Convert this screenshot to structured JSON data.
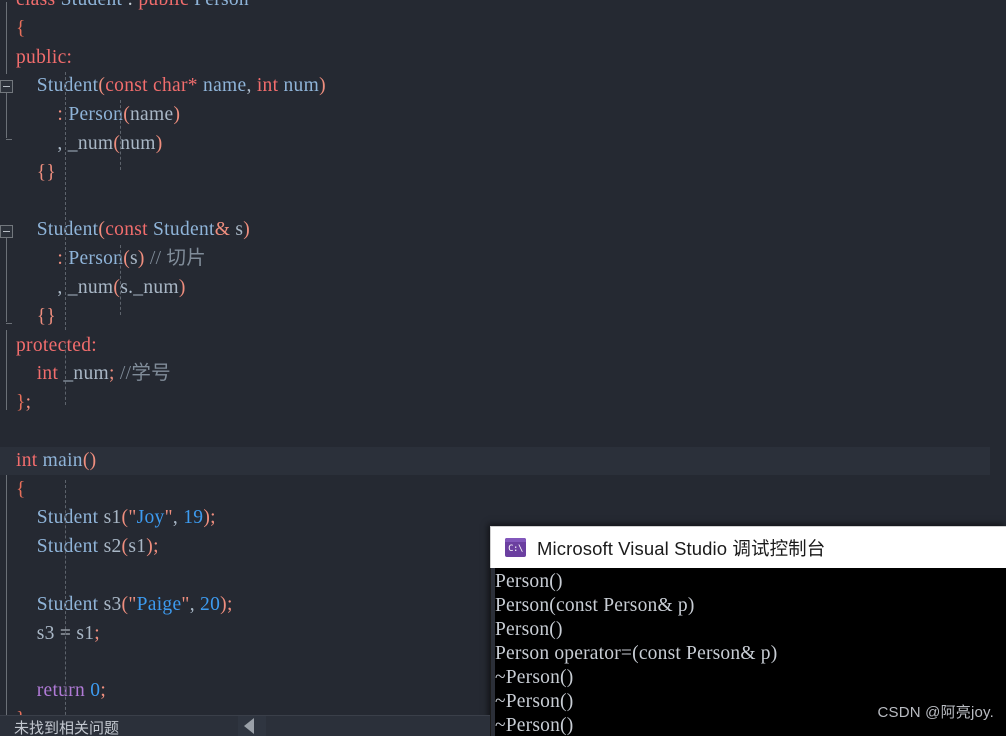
{
  "window": {
    "app": "Visual Studio Code Editor",
    "language": "C++"
  },
  "editor": {
    "lines": [
      {
        "indent": 0,
        "tokens": [
          {
            "t": "class ",
            "c": "kw"
          },
          {
            "t": "Student ",
            "c": "type"
          },
          {
            "t": ": ",
            "c": "op"
          },
          {
            "t": "public ",
            "c": "kw"
          },
          {
            "t": "Person",
            "c": "type"
          }
        ]
      },
      {
        "indent": 0,
        "tokens": [
          {
            "t": "{",
            "c": "brace"
          }
        ]
      },
      {
        "indent": 0,
        "tokens": [
          {
            "t": "public",
            "c": "kw"
          },
          {
            "t": ":",
            "c": "kw"
          }
        ]
      },
      {
        "indent": 1,
        "tokens": [
          {
            "t": "Student",
            "c": "type"
          },
          {
            "t": "(",
            "c": "punc"
          },
          {
            "t": "const ",
            "c": "kw"
          },
          {
            "t": "char*",
            "c": "kw"
          },
          {
            "t": " name",
            "c": "type"
          },
          {
            "t": ", ",
            "c": "id"
          },
          {
            "t": "int ",
            "c": "kw"
          },
          {
            "t": "num",
            "c": "type"
          },
          {
            "t": ")",
            "c": "punc"
          }
        ]
      },
      {
        "indent": 2,
        "tokens": [
          {
            "t": ": ",
            "c": "punc"
          },
          {
            "t": "Person",
            "c": "type"
          },
          {
            "t": "(",
            "c": "punc"
          },
          {
            "t": "name",
            "c": "id"
          },
          {
            "t": ")",
            "c": "punc"
          }
        ]
      },
      {
        "indent": 2,
        "tokens": [
          {
            "t": ", ",
            "c": "id"
          },
          {
            "t": "_num",
            "c": "id"
          },
          {
            "t": "(",
            "c": "punc"
          },
          {
            "t": "num",
            "c": "id"
          },
          {
            "t": ")",
            "c": "punc"
          }
        ]
      },
      {
        "indent": 1,
        "tokens": [
          {
            "t": "{}",
            "c": "punc"
          }
        ]
      },
      {
        "indent": 0,
        "tokens": []
      },
      {
        "indent": 1,
        "tokens": [
          {
            "t": "Student",
            "c": "type"
          },
          {
            "t": "(",
            "c": "punc"
          },
          {
            "t": "const ",
            "c": "kw"
          },
          {
            "t": "Student",
            "c": "type"
          },
          {
            "t": "& ",
            "c": "punc"
          },
          {
            "t": "s",
            "c": "id"
          },
          {
            "t": ")",
            "c": "punc"
          }
        ]
      },
      {
        "indent": 2,
        "tokens": [
          {
            "t": ": ",
            "c": "punc"
          },
          {
            "t": "Person",
            "c": "type"
          },
          {
            "t": "(",
            "c": "punc"
          },
          {
            "t": "s",
            "c": "id"
          },
          {
            "t": ") ",
            "c": "punc"
          },
          {
            "t": "// 切片",
            "c": "cmt"
          }
        ]
      },
      {
        "indent": 2,
        "tokens": [
          {
            "t": ", ",
            "c": "id"
          },
          {
            "t": "_num",
            "c": "id"
          },
          {
            "t": "(",
            "c": "punc"
          },
          {
            "t": "s.",
            "c": "id"
          },
          {
            "t": "_num",
            "c": "id"
          },
          {
            "t": ")",
            "c": "punc"
          }
        ]
      },
      {
        "indent": 1,
        "tokens": [
          {
            "t": "{}",
            "c": "punc"
          }
        ]
      },
      {
        "indent": 0,
        "tokens": [
          {
            "t": "protected",
            "c": "kw"
          },
          {
            "t": ":",
            "c": "kw"
          }
        ]
      },
      {
        "indent": 1,
        "tokens": [
          {
            "t": "int ",
            "c": "kw"
          },
          {
            "t": "_num",
            "c": "id"
          },
          {
            "t": "; ",
            "c": "punc"
          },
          {
            "t": "//学号",
            "c": "cmt"
          }
        ]
      },
      {
        "indent": 0,
        "tokens": [
          {
            "t": "}",
            "c": "brace"
          },
          {
            "t": ";",
            "c": "punc"
          }
        ]
      },
      {
        "indent": 0,
        "tokens": []
      },
      {
        "indent": 0,
        "tokens": [
          {
            "t": "int ",
            "c": "kw"
          },
          {
            "t": "main",
            "c": "type"
          },
          {
            "t": "()",
            "c": "punc"
          }
        ],
        "highlight": true
      },
      {
        "indent": 0,
        "tokens": [
          {
            "t": "{",
            "c": "brace"
          }
        ]
      },
      {
        "indent": 1,
        "tokens": [
          {
            "t": "Student ",
            "c": "type"
          },
          {
            "t": "s1",
            "c": "id"
          },
          {
            "t": "(",
            "c": "punc"
          },
          {
            "t": "\"",
            "c": "punc"
          },
          {
            "t": "Joy",
            "c": "str"
          },
          {
            "t": "\"",
            "c": "punc"
          },
          {
            "t": ", ",
            "c": "id"
          },
          {
            "t": "19",
            "c": "num"
          },
          {
            "t": ");",
            "c": "punc"
          }
        ]
      },
      {
        "indent": 1,
        "tokens": [
          {
            "t": "Student ",
            "c": "type"
          },
          {
            "t": "s2",
            "c": "id"
          },
          {
            "t": "(",
            "c": "punc"
          },
          {
            "t": "s1",
            "c": "id"
          },
          {
            "t": ");",
            "c": "punc"
          }
        ]
      },
      {
        "indent": 0,
        "tokens": []
      },
      {
        "indent": 1,
        "tokens": [
          {
            "t": "Student ",
            "c": "type"
          },
          {
            "t": "s3",
            "c": "id"
          },
          {
            "t": "(",
            "c": "punc"
          },
          {
            "t": "\"",
            "c": "punc"
          },
          {
            "t": "Paige",
            "c": "str"
          },
          {
            "t": "\"",
            "c": "punc"
          },
          {
            "t": ", ",
            "c": "id"
          },
          {
            "t": "20",
            "c": "num"
          },
          {
            "t": ");",
            "c": "punc"
          }
        ]
      },
      {
        "indent": 1,
        "tokens": [
          {
            "t": "s3 ",
            "c": "id"
          },
          {
            "t": "= ",
            "c": "op"
          },
          {
            "t": "s1",
            "c": "id"
          },
          {
            "t": ";",
            "c": "punc"
          }
        ]
      },
      {
        "indent": 0,
        "tokens": []
      },
      {
        "indent": 1,
        "tokens": [
          {
            "t": "return ",
            "c": "ret"
          },
          {
            "t": "0",
            "c": "num"
          },
          {
            "t": ";",
            "c": "punc"
          }
        ]
      },
      {
        "indent": 0,
        "tokens": [
          {
            "t": "}",
            "c": "brace"
          }
        ]
      }
    ],
    "plain_text": [
      "class Student : public Person",
      "{",
      "public:",
      "    Student(const char* name, int num)",
      "        : Person(name)",
      "        , _num(num)",
      "    {}",
      "",
      "    Student(const Student& s)",
      "        : Person(s) // 切片",
      "        , _num(s._num)",
      "    {}",
      "protected:",
      "    int _num; //学号",
      "};",
      "",
      "int main()",
      "{",
      "    Student s1(\"Joy\", 19);",
      "    Student s2(s1);",
      "",
      "    Student s3(\"Paige\", 20);",
      "    s3 = s1;",
      "",
      "    return 0;",
      "}"
    ]
  },
  "console": {
    "title": "Microsoft Visual Studio 调试控制台",
    "icon": "console-cmd-icon",
    "icon_glyph": "C:\\",
    "output": [
      "Person()",
      "Person(const Person& p)",
      "Person()",
      "Person operator=(const Person& p)",
      "~Person()",
      "~Person()",
      "~Person()"
    ]
  },
  "status_bar": {
    "message": "未找到相关问题",
    "collapse_arrow": "◀"
  },
  "watermark": {
    "text": "CSDN @阿亮joy."
  },
  "colors": {
    "editor_bg": "#252932",
    "keyword": "#f26d6d",
    "type": "#8fb4d9",
    "string": "#3d9bf0",
    "comment": "#808c99",
    "return_kw": "#b07ad6",
    "console_bg": "#000000",
    "console_title_bg": "#ffffff",
    "console_icon": "#6b3fa0"
  }
}
